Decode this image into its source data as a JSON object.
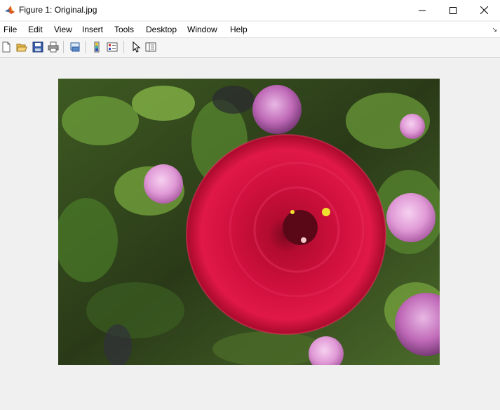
{
  "window": {
    "title": "Figure 1: Original.jpg",
    "app_icon": "matlab-logo-icon",
    "controls": [
      "minimize-icon",
      "maximize-icon",
      "close-icon"
    ]
  },
  "menu": {
    "items": [
      {
        "label": "File"
      },
      {
        "label": "Edit"
      },
      {
        "label": "View"
      },
      {
        "label": "Insert"
      },
      {
        "label": "Tools"
      },
      {
        "label": "Desktop"
      },
      {
        "label": "Window"
      },
      {
        "label": "Help"
      }
    ],
    "dock_icon": "dock-figure-icon"
  },
  "toolbar": {
    "buttons": [
      {
        "icon": "new-figure-icon"
      },
      {
        "icon": "open-file-icon"
      },
      {
        "icon": "save-icon"
      },
      {
        "icon": "print-icon"
      },
      {
        "icon": "link-plot-icon"
      },
      {
        "icon": "insert-colorbar-icon"
      },
      {
        "icon": "insert-legend-icon"
      },
      {
        "icon": "edit-plot-arrow-icon"
      },
      {
        "icon": "show-plot-tools-icon"
      }
    ]
  },
  "figure": {
    "image": "red-zinnia-flower-photo",
    "colors": {
      "flower": "#c8103a",
      "leaves": "#4a7a2a",
      "globe_amaranth": "#e49fd8"
    }
  }
}
